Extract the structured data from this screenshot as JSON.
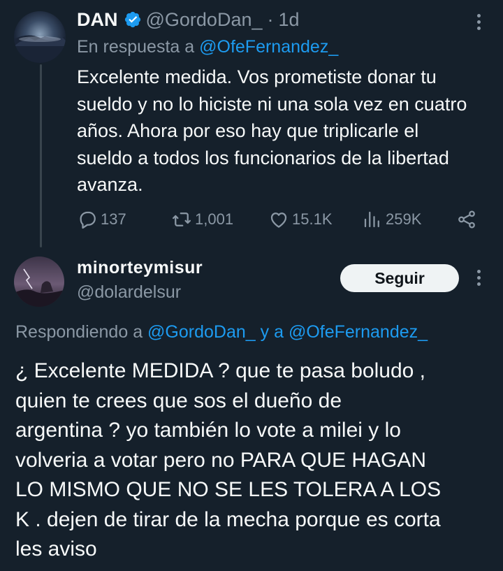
{
  "tweet1": {
    "display_name": "DAN",
    "handle": "@GordoDan_",
    "separator": "·",
    "time": "1d",
    "reply_prefix": "En respuesta a",
    "reply_to": "@OfeFernandez_",
    "body": "Excelente medida. Vos prometiste donar tu\nsueldo y no lo hiciste ni una sola vez en cuatro\naños. Ahora por eso hay que triplicarle el\nsueldo a todos los funcionarios de la libertad\navanza.",
    "stats": {
      "replies": "137",
      "retweets": "1,001",
      "likes": "15.1K",
      "views": "259K"
    }
  },
  "tweet2": {
    "display_name": "minorteymisur",
    "handle": "@dolardelsur",
    "follow_label": "Seguir",
    "reply_prefix": "Respondiendo a",
    "reply_to_1": "@GordoDan_",
    "reply_joiner": "y a",
    "reply_to_2": "@OfeFernandez_",
    "body": "¿ Excelente MEDIDA ? que te pasa boludo ,\nquien te crees que sos el dueño de\nargentina ? yo también lo vote a milei y lo\nvolveria a votar pero no PARA QUE HAGAN\nLO MISMO QUE NO SE LES TOLERA A LOS\nK . dejen de tirar de la mecha porque es corta\nles aviso"
  },
  "colors": {
    "background": "#15202b",
    "text": "#f7f9f9",
    "secondary": "#8b98a5",
    "accent": "#1d9bf0",
    "thread_line": "#38444d"
  },
  "icons": [
    "verified-badge-icon",
    "more-icon",
    "reply-icon",
    "retweet-icon",
    "like-icon",
    "views-icon",
    "share-icon"
  ]
}
